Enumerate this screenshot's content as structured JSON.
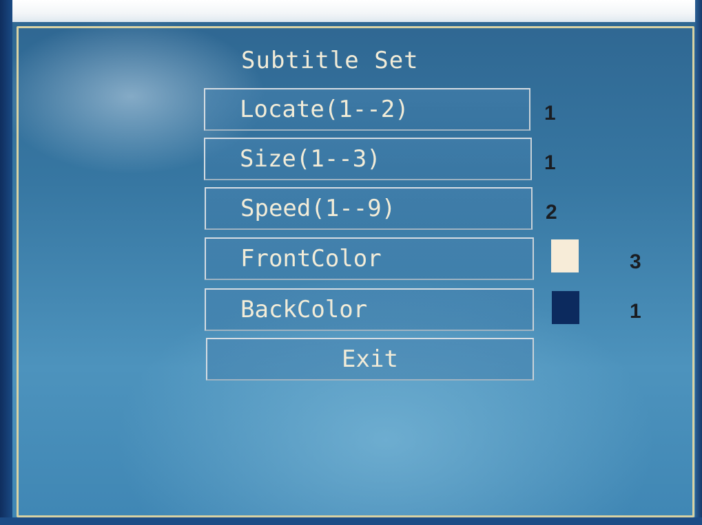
{
  "menu": {
    "title": "Subtitle Set",
    "items": [
      {
        "label": "Locate(1--2)",
        "value": "1"
      },
      {
        "label": "Size(1--3)",
        "value": "1"
      },
      {
        "label": "Speed(1--9)",
        "value": "2"
      },
      {
        "label": "FrontColor",
        "value": "3",
        "swatch_color": "#f7ecd8"
      },
      {
        "label": "BackColor",
        "value": "1",
        "swatch_color": "#0c2a5e"
      },
      {
        "label": "Exit"
      }
    ]
  },
  "colors": {
    "background": "#3a7aa6",
    "frame_border": "#d9d2a3",
    "text": "#f2ecd8",
    "value_text": "#1a1d22"
  }
}
